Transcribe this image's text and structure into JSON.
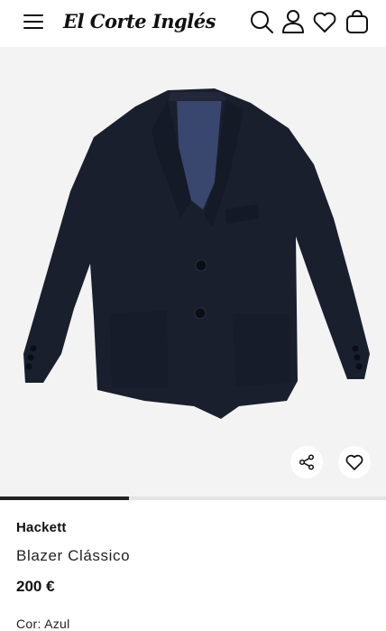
{
  "header": {
    "logo_text": "El Corte Inglés",
    "icons": [
      "menu-icon",
      "search-icon",
      "user-icon",
      "heart-icon",
      "bag-icon"
    ]
  },
  "gallery": {
    "image_description_icon": "navy-blazer",
    "image_count": 3,
    "current_image": 1,
    "share_icon": "share-icon",
    "wishlist_icon": "heart-icon"
  },
  "product": {
    "brand": "Hackett",
    "name": "Blazer Clássico",
    "price": "200 €",
    "color_label": "Cor:",
    "color_value": "Azul"
  },
  "colors": {
    "garment": "#1a1f2e",
    "lining": "#39466e",
    "background": "#f3f3f3",
    "text": "#111111"
  }
}
